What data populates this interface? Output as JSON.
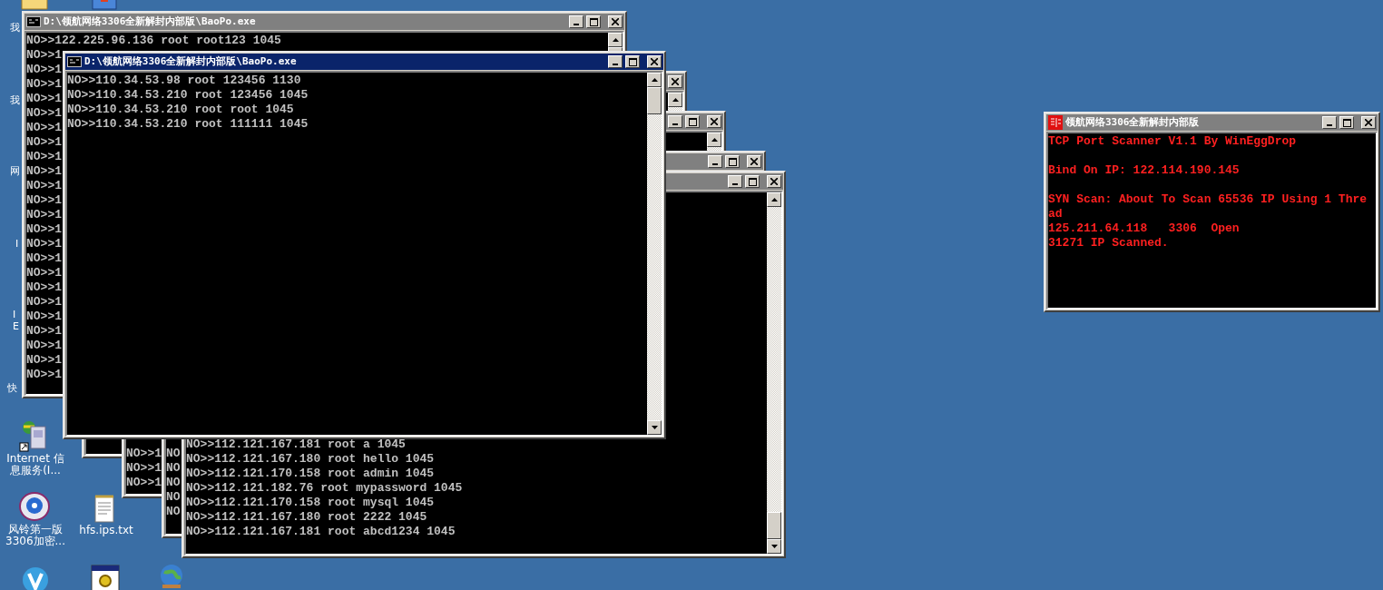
{
  "desktop_icons": [
    {
      "kind": "folder"
    },
    {
      "kind": "package"
    },
    {
      "kind": "hidden",
      "label": "我"
    },
    {
      "kind": "hidden",
      "label": "我"
    },
    {
      "kind": "hidden",
      "label": "网"
    },
    {
      "kind": "hidden",
      "label": "I"
    },
    {
      "kind": "hidden",
      "label": "I"
    },
    {
      "kind": "hidden",
      "label": "E"
    },
    {
      "kind": "hidden",
      "label": "快"
    },
    {
      "kind": "server",
      "label": "Internet 信息服务(I..."
    },
    {
      "kind": "disc",
      "label": "风铃第一版3306加密..."
    },
    {
      "kind": "notepad",
      "label": "hfs.ips.txt"
    },
    {
      "kind": "v-app"
    },
    {
      "kind": "settings"
    },
    {
      "kind": "globe"
    }
  ],
  "windows": [
    {
      "kind": "console",
      "active": false,
      "title": "D:\\领航网络3306全新解封内部版\\BaoPo.exe",
      "lines": [
        "NO>>122.225.96.136 root root123 1045",
        "NO>>1",
        "NO>>1",
        "NO>>1",
        "NO>>1",
        "NO>>1",
        "NO>>1",
        "NO>>1",
        "NO>>1",
        "NO>>1",
        "NO>>1",
        "NO>>1",
        "NO>>1",
        "NO>>1",
        "NO>>1",
        "NO>>1",
        "NO>>1",
        "NO>>1",
        "NO>>1",
        "NO>>1",
        "NO>>1",
        "NO>>1",
        "NO>>1",
        "NO>>1"
      ]
    },
    {
      "kind": "console",
      "active": false
    },
    {
      "kind": "console",
      "active": false,
      "lines": [
        "NO>>1",
        "NO>>1",
        "NO>>1"
      ]
    },
    {
      "kind": "console",
      "active": false,
      "lines": [
        "NO",
        "NO",
        "NO",
        "NO",
        "NO"
      ]
    },
    {
      "kind": "console",
      "active": false,
      "lines": [
        "NO>>112.121.167.181 root a 1045",
        "NO>>112.121.167.180 root hello 1045",
        "NO>>112.121.170.158 root admin 1045",
        "NO>>112.121.182.76 root mypassword 1045",
        "NO>>112.121.170.158 root mysql 1045",
        "NO>>112.121.167.180 root 2222 1045",
        "NO>>112.121.167.181 root abcd1234 1045"
      ]
    },
    {
      "kind": "console",
      "active": true,
      "title": "D:\\领航网络3306全新解封内部版\\BaoPo.exe",
      "lines": [
        "NO>>110.34.53.98 root 123456 1130",
        "NO>>110.34.53.210 root 123456 1045",
        "NO>>110.34.53.210 root root 1045",
        "NO>>110.34.53.210 root 111111 1045"
      ]
    },
    {
      "kind": "scanner",
      "active": false,
      "title": "领航网络3306全新解封内部版",
      "blocks": [
        [
          "TCP Port Scanner V1.1 By WinEggDrop"
        ],
        [
          "Bind On IP: 122.114.190.145"
        ],
        [
          "SYN Scan: About To Scan 65536 IP Using 1 Thre",
          "ad",
          "125.211.64.118   3306  Open",
          "31271 IP Scanned."
        ]
      ]
    }
  ]
}
